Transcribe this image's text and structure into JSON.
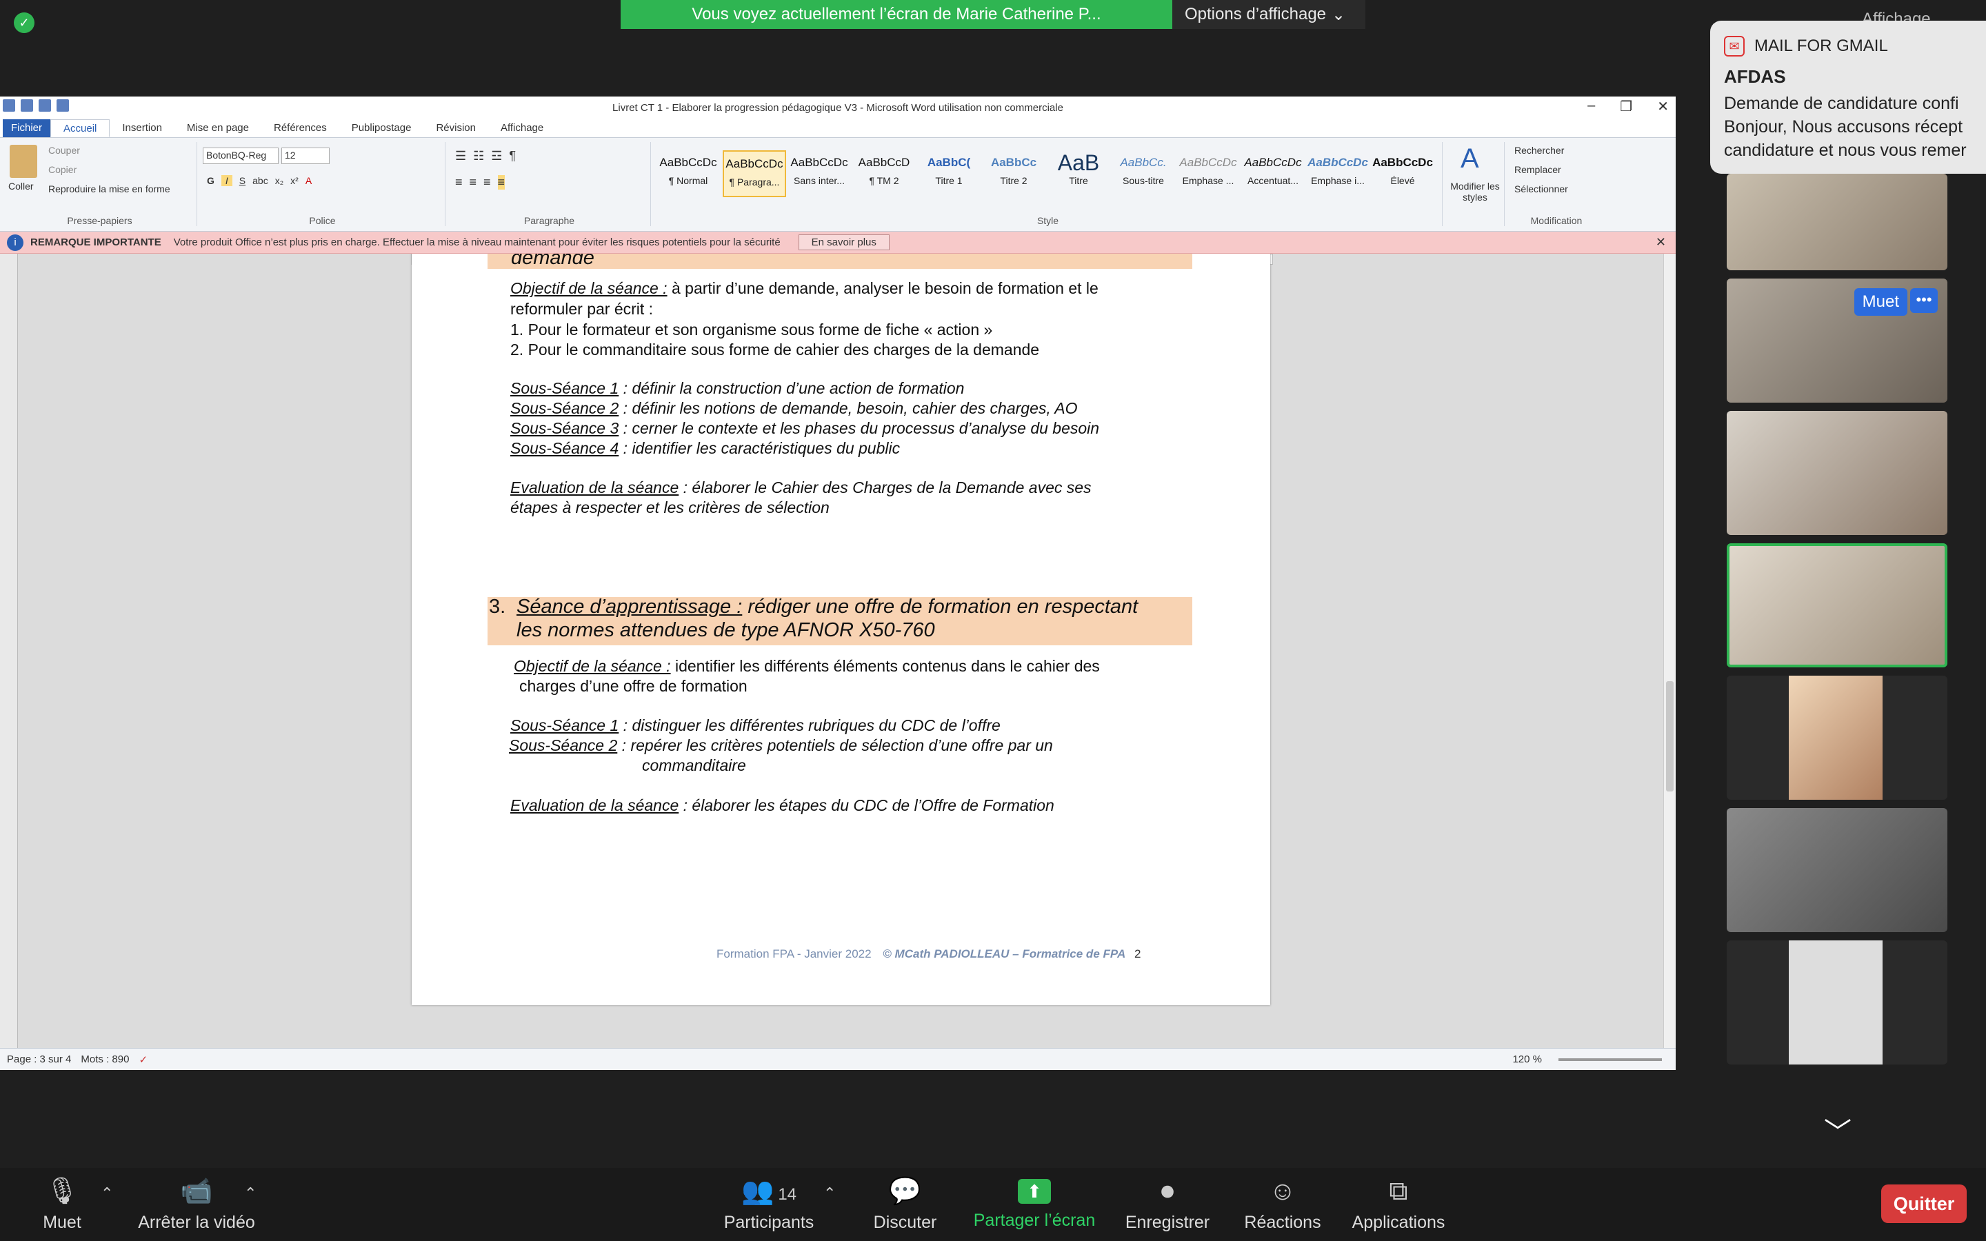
{
  "zoom_meeting": {
    "share_banner": "Vous voyez actuellement l’écran de Marie Catherine P...",
    "view_options": "Options d’affichage",
    "affichage": "Affichage",
    "muted_label": "Muet",
    "participants_count": "14",
    "toolbar": {
      "mute": "Muet",
      "stop_video": "Arrêter la vidéo",
      "participants": "Participants",
      "chat": "Discuter",
      "share": "Partager l’écran",
      "record": "Enregistrer",
      "reactions": "Réactions",
      "apps": "Applications",
      "quit": "Quitter"
    }
  },
  "notification": {
    "app": "MAIL FOR GMAIL",
    "from": "AFDAS",
    "lines": [
      "Demande de candidature confi",
      "Bonjour, Nous accusons récept",
      "candidature et nous vous remer"
    ]
  },
  "word": {
    "title": "Livret CT 1 - Elaborer la progression pédagogique V3  -  Microsoft Word utilisation non commerciale",
    "tabs": [
      "Fichier",
      "Accueil",
      "Insertion",
      "Mise en page",
      "Références",
      "Publipostage",
      "Révision",
      "Affichage"
    ],
    "clipboard": {
      "paste": "Coller",
      "cut": "Couper",
      "copy": "Copier",
      "format_painter": "Reproduire la mise en forme",
      "group": "Presse-papiers"
    },
    "font": {
      "name": "BotonBQ-Reg",
      "size": "12",
      "group": "Police"
    },
    "paragraph_group": "Paragraphe",
    "styles": [
      {
        "preview": "AaBbCcDc",
        "label": "¶ Normal"
      },
      {
        "preview": "AaBbCcDc",
        "label": "¶ Paragra..."
      },
      {
        "preview": "AaBbCcDc",
        "label": "Sans inter..."
      },
      {
        "preview": "AaBbCcD",
        "label": "¶ TM 2"
      },
      {
        "preview": "AaBbC(",
        "label": "Titre 1"
      },
      {
        "preview": "AaBbCc",
        "label": "Titre 2"
      },
      {
        "preview": "AaB",
        "label": "Titre"
      },
      {
        "preview": "AaBbCc.",
        "label": "Sous-titre"
      },
      {
        "preview": "AaBbCcDc",
        "label": "Emphase ..."
      },
      {
        "preview": "AaBbCcDc",
        "label": "Accentuat..."
      },
      {
        "preview": "AaBbCcDc",
        "label": "Emphase i..."
      },
      {
        "preview": "AaBbCcDc",
        "label": "Élevé"
      }
    ],
    "styles_group": "Style",
    "change_styles": "Modifier les styles",
    "editing": {
      "find": "Rechercher",
      "replace": "Remplacer",
      "select": "Sélectionner",
      "group": "Modification"
    },
    "notice": {
      "label": "REMARQUE IMPORTANTE",
      "text": "Votre produit Office n’est plus pris en charge. Effectuer la mise à niveau maintenant pour éviter les risques potentiels pour la sécurité",
      "button": "En savoir plus"
    },
    "status": {
      "page": "Page : 3 sur 4",
      "words": "Mots : 890",
      "zoom": "120 %"
    },
    "doc": {
      "top_heading_tail": "demande",
      "obj1_label": "Objectif de la séance :",
      "obj1_text": " à partir d’une demande, analyser le besoin de formation et le",
      "obj1_text2": "reformuler par écrit :",
      "list1": "1.  Pour le formateur et son organisme sous forme de fiche « action »",
      "list2": "2.  Pour le commanditaire sous forme de cahier des charges de la demande",
      "ss1_label": "Sous-Séance 1",
      "ss1_text": " : définir la construction d’une action de formation",
      "ss2_label": "Sous-Séance 2",
      "ss2_text": " : définir les notions de demande, besoin, cahier des charges, AO",
      "ss3_label": "Sous-Séance 3",
      "ss3_text": " : cerner le contexte et les phases du processus d’analyse du besoin",
      "ss4_label": "Sous-Séance 4",
      "ss4_text": " : identifier les caractéristiques du public",
      "eval1_label": "Evaluation de la séance",
      "eval1_text": " : élaborer le Cahier des Charges de la Demande avec ses",
      "eval1_text2": "étapes à respecter et les critères de sélection",
      "h3_num": "3.",
      "h3_label": "Séance d’apprentissage :",
      "h3_text": " rédiger une offre de formation en respectant",
      "h3_text2": "les normes attendues de type AFNOR X50-760",
      "obj3_label": "Objectif de la séance :",
      "obj3_text": " identifier les différents éléments contenus dans le cahier des",
      "obj3_text2": "charges d’une offre de formation",
      "ss31_label": "Sous-Séance 1",
      "ss31_text": " : distinguer les différentes rubriques du CDC de l’offre",
      "ss32_label": "Sous-Séance 2",
      "ss32_text": " : repérer les critères potentiels de sélection d’une offre par un",
      "ss32_text2": "commanditaire",
      "eval3_label": "Evaluation de la séance",
      "eval3_text": " : élaborer les étapes du CDC de l’Offre de Formation",
      "footer_left": "Formation FPA - Janvier 2022",
      "footer_right": "© MCath PADIOLLEAU – Formatrice de FPA",
      "page_number": "2"
    }
  },
  "colors": {
    "zoom_green": "#2fb552",
    "quit_red": "#d73b3b",
    "heading_highlight": "#f8d3b3",
    "notice_bg": "#f7c9c9"
  }
}
